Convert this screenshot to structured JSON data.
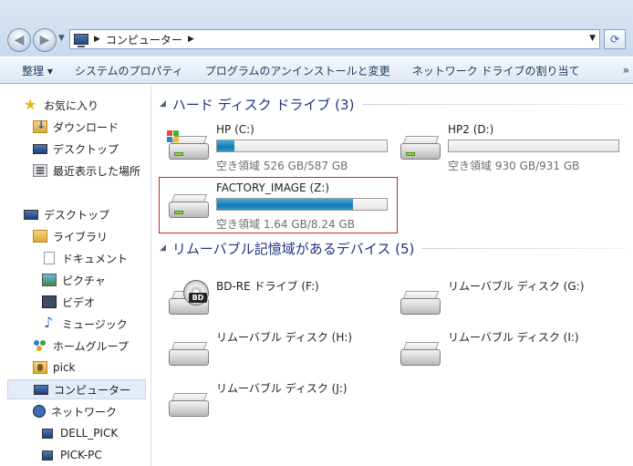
{
  "address": {
    "breadcrumb": "コンピューター"
  },
  "toolbar": {
    "items": [
      "整理 ▾",
      "システムのプロパティ",
      "プログラムのアンインストールと変更",
      "ネットワーク ドライブの割り当て"
    ],
    "more": "»"
  },
  "sidebar": {
    "items": [
      {
        "label": "お気に入り",
        "icon": "star-icon"
      },
      {
        "label": "ダウンロード",
        "icon": "downloads-folder-icon"
      },
      {
        "label": "デスクトップ",
        "icon": "desktop-icon"
      },
      {
        "label": "最近表示した場所",
        "icon": "recent-places-icon"
      },
      {
        "label": "デスクトップ",
        "icon": "desktop-icon"
      },
      {
        "label": "ライブラリ",
        "icon": "library-icon"
      },
      {
        "label": "ドキュメント",
        "icon": "document-icon"
      },
      {
        "label": "ピクチャ",
        "icon": "pictures-icon"
      },
      {
        "label": "ビデオ",
        "icon": "video-icon"
      },
      {
        "label": "ミュージック",
        "icon": "music-icon"
      },
      {
        "label": "ホームグループ",
        "icon": "homegroup-icon"
      },
      {
        "label": "pick",
        "icon": "user-folder-icon"
      },
      {
        "label": "コンピューター",
        "icon": "computer-icon",
        "selected": true
      },
      {
        "label": "ネットワーク",
        "icon": "network-icon"
      },
      {
        "label": "DELL_PICK",
        "icon": "network-computer-icon"
      },
      {
        "label": "PICK-PC",
        "icon": "network-computer-icon"
      }
    ]
  },
  "groups": {
    "hdd": {
      "title": "ハード ディスク ドライブ (3)"
    },
    "removable": {
      "title": "リムーバブル記憶域があるデバイス (5)"
    }
  },
  "drives": {
    "c": {
      "name": "HP (C:)",
      "free": "空き領域 526 GB/587 GB",
      "used_fraction": 0.104
    },
    "d": {
      "name": "HP2 (D:)",
      "free": "空き領域 930 GB/931 GB",
      "used_fraction": 0.001
    },
    "z": {
      "name": "FACTORY_IMAGE (Z:)",
      "free": "空き領域 1.64 GB/8.24 GB",
      "used_fraction": 0.801
    }
  },
  "removable": {
    "f": {
      "name": "BD-RE ドライブ (F:)",
      "badge": "BD"
    },
    "g": {
      "name": "リムーバブル ディスク (G:)"
    },
    "h": {
      "name": "リムーバブル ディスク (H:)"
    },
    "i": {
      "name": "リムーバブル ディスク (I:)"
    },
    "j": {
      "name": "リムーバブル ディスク (J:)"
    }
  },
  "colors": {
    "group_header": "#1e3287",
    "bar_fill": "#1a78b0",
    "highlight_box": "#cc2222"
  }
}
